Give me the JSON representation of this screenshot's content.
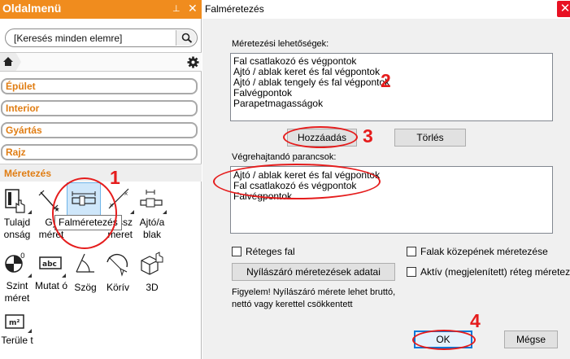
{
  "side_panel": {
    "title": "Oldalmenü",
    "pin_glyph": "⊥",
    "close_glyph": "✕",
    "search_text": "[Keresés minden elemre]",
    "categories": [
      "Épület",
      "Interior",
      "Gyártás",
      "Rajz"
    ],
    "active_category": "Méretezés",
    "tools": [
      {
        "name": "tool-tulajdonsag",
        "label": "Tulajd onság",
        "icon": "properties-icon"
      },
      {
        "name": "tool-gyors-meret",
        "label": "Gy méret",
        "icon": "quick-dim-icon"
      },
      {
        "name": "tool-falmeretezes",
        "label": "",
        "icon": "wall-dim-icon"
      },
      {
        "name": "tool-tengely-meret",
        "label": "ssz meret",
        "icon": "axis-dim-icon"
      },
      {
        "name": "tool-ajto-ablak",
        "label": "Ajtó/a blak",
        "icon": "door-window-dim-icon"
      },
      {
        "name": "tool-szint-meret",
        "label": "Szint méret",
        "icon": "level-dim-icon"
      },
      {
        "name": "tool-mutato",
        "label": "Mutat ó",
        "icon": "pointer-text-icon"
      },
      {
        "name": "tool-szog",
        "label": "Szög",
        "icon": "angle-icon"
      },
      {
        "name": "tool-korív",
        "label": "Körív",
        "icon": "arc-icon"
      },
      {
        "name": "tool-3d",
        "label": "3D",
        "icon": "3d-box-icon"
      },
      {
        "name": "tool-terulet",
        "label": "Terüle t",
        "icon": "area-icon"
      }
    ],
    "tooltip": "Falméretezés",
    "accent_color": "#f08c1e"
  },
  "dialog": {
    "title": "Falméretezés",
    "options_label": "Méretezési lehetőségek:",
    "options": [
      "Fal csatlakozó és végpontok",
      "Ajtó / ablak keret és fal végpontok",
      "Ajtó / ablak tengely és fal végpontok",
      "Falvégpontok",
      "Parapetmagasságok"
    ],
    "add_button": "Hozzáadás",
    "delete_button": "Törlés",
    "commands_label": "Végrehajtandó parancsok:",
    "commands": [
      "Ajtó / ablak keret és fal végpontok",
      "Fal csatlakozó és végpontok",
      "Falvégpontok"
    ],
    "layered_wall": "Réteges fal",
    "wall_center_dim": "Falak közepének méretezése",
    "opening_data_button": "Nyílászáró méretezések adatai",
    "active_layer_dim": "Aktív (megjelenített) réteg méretezése",
    "warning_line1": "Figyelem! Nyílászáró mérete lehet bruttó,",
    "warning_line2": "nettó vagy kerettel csökkentett",
    "ok_button": "OK",
    "cancel_button": "Mégse",
    "close_glyph": "✕"
  },
  "annotations": {
    "numbers": [
      "1",
      "2",
      "3",
      "4"
    ],
    "color": "#e51c1c"
  }
}
